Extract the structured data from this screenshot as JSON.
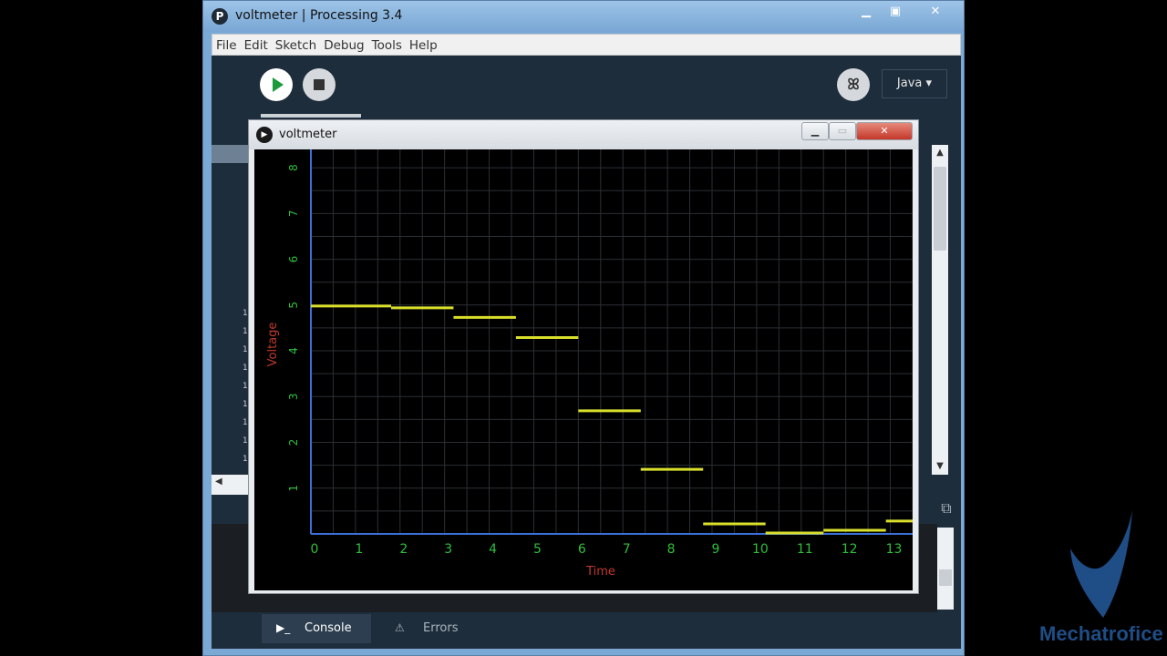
{
  "ide": {
    "title": "voltmeter | Processing 3.4",
    "menu": [
      "File",
      "Edit",
      "Sketch",
      "Debug",
      "Tools",
      "Help"
    ],
    "mode": "Java",
    "debug_icon": "butterfly-icon",
    "console_tab": "Console",
    "errors_tab": "Errors"
  },
  "sketch": {
    "title": "voltmeter",
    "close_glyph": "✕"
  },
  "watermark": {
    "text": "Mechatrofice"
  },
  "colors": {
    "plot_line": "#d9df2a",
    "axis": "#3a6fd8",
    "grid": "#2a2f35",
    "tick_label": "#2fbf3a",
    "axis_label": "#c0392b"
  },
  "chart_data": {
    "type": "line",
    "xlabel": "Time",
    "ylabel": "Voltage",
    "xlim": [
      0,
      13.5
    ],
    "ylim": [
      0,
      8.4
    ],
    "x_ticks": [
      0,
      1,
      2,
      3,
      4,
      5,
      6,
      7,
      8,
      9,
      10,
      11,
      12,
      13
    ],
    "y_ticks": [
      1,
      2,
      3,
      4,
      5,
      6,
      7,
      8
    ],
    "grid": true,
    "series": [
      {
        "segments": [
          {
            "x0": 0.0,
            "x1": 1.8,
            "y": 4.98
          },
          {
            "x0": 1.8,
            "x1": 3.2,
            "y": 4.94
          },
          {
            "x0": 3.2,
            "x1": 4.6,
            "y": 4.73
          },
          {
            "x0": 4.6,
            "x1": 6.0,
            "y": 4.29
          },
          {
            "x0": 6.0,
            "x1": 7.4,
            "y": 2.69
          },
          {
            "x0": 7.4,
            "x1": 8.8,
            "y": 1.41
          },
          {
            "x0": 8.8,
            "x1": 10.2,
            "y": 0.22
          },
          {
            "x0": 10.2,
            "x1": 11.5,
            "y": 0.02
          },
          {
            "x0": 11.5,
            "x1": 12.9,
            "y": 0.08
          },
          {
            "x0": 12.9,
            "x1": 13.5,
            "y": 0.28
          }
        ]
      }
    ]
  }
}
